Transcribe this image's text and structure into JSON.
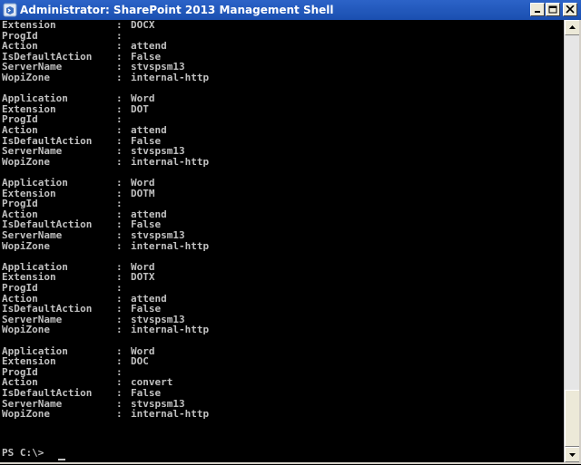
{
  "window": {
    "title": "Administrator: SharePoint 2013 Management Shell",
    "icon": "powershell-icon",
    "controls": [
      "minimize-icon",
      "maximize-icon",
      "close-icon"
    ]
  },
  "console": {
    "partial_block": [
      {
        "key": "Extension",
        "value": "DOCX"
      },
      {
        "key": "ProgId",
        "value": ""
      },
      {
        "key": "Action",
        "value": "attend"
      },
      {
        "key": "IsDefaultAction",
        "value": "False"
      },
      {
        "key": "ServerName",
        "value": "stvspsm13"
      },
      {
        "key": "WopiZone",
        "value": "internal-http"
      }
    ],
    "blocks": [
      [
        {
          "key": "Application",
          "value": "Word"
        },
        {
          "key": "Extension",
          "value": "DOT"
        },
        {
          "key": "ProgId",
          "value": ""
        },
        {
          "key": "Action",
          "value": "attend"
        },
        {
          "key": "IsDefaultAction",
          "value": "False"
        },
        {
          "key": "ServerName",
          "value": "stvspsm13"
        },
        {
          "key": "WopiZone",
          "value": "internal-http"
        }
      ],
      [
        {
          "key": "Application",
          "value": "Word"
        },
        {
          "key": "Extension",
          "value": "DOTM"
        },
        {
          "key": "ProgId",
          "value": ""
        },
        {
          "key": "Action",
          "value": "attend"
        },
        {
          "key": "IsDefaultAction",
          "value": "False"
        },
        {
          "key": "ServerName",
          "value": "stvspsm13"
        },
        {
          "key": "WopiZone",
          "value": "internal-http"
        }
      ],
      [
        {
          "key": "Application",
          "value": "Word"
        },
        {
          "key": "Extension",
          "value": "DOTX"
        },
        {
          "key": "ProgId",
          "value": ""
        },
        {
          "key": "Action",
          "value": "attend"
        },
        {
          "key": "IsDefaultAction",
          "value": "False"
        },
        {
          "key": "ServerName",
          "value": "stvspsm13"
        },
        {
          "key": "WopiZone",
          "value": "internal-http"
        }
      ],
      [
        {
          "key": "Application",
          "value": "Word"
        },
        {
          "key": "Extension",
          "value": "DOC"
        },
        {
          "key": "ProgId",
          "value": ""
        },
        {
          "key": "Action",
          "value": "convert"
        },
        {
          "key": "IsDefaultAction",
          "value": "False"
        },
        {
          "key": "ServerName",
          "value": "stvspsm13"
        },
        {
          "key": "WopiZone",
          "value": "internal-http"
        }
      ]
    ],
    "separator": ":",
    "prompt": "PS C:\\>"
  },
  "colors": {
    "titlebar": "#1a4fb0",
    "console_bg": "#000000",
    "console_text": "#c0c0c0"
  }
}
